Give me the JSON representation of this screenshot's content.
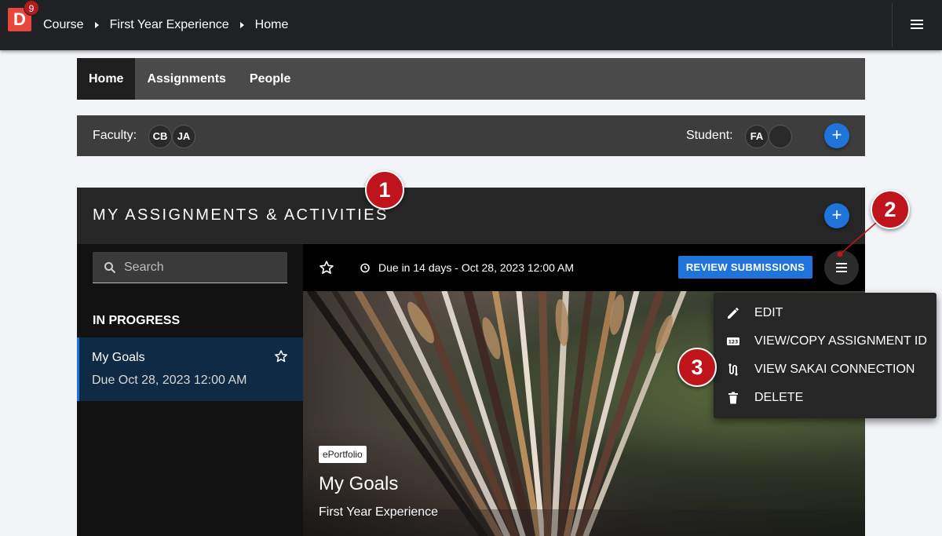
{
  "header": {
    "logo_letter": "D",
    "notification_count": "9",
    "breadcrumb": [
      "Course",
      "First Year Experience",
      "Home"
    ]
  },
  "course_nav": {
    "tabs": [
      {
        "label": "Home",
        "active": true
      },
      {
        "label": "Assignments",
        "active": false
      },
      {
        "label": "People",
        "active": false
      }
    ]
  },
  "members": {
    "faculty_label": "Faculty:",
    "faculty": [
      "CB",
      "JA"
    ],
    "student_label": "Student:",
    "students": [
      "FA",
      ""
    ],
    "add_symbol": "+"
  },
  "assignments": {
    "title": "MY ASSIGNMENTS & ACTIVITIES",
    "add_symbol": "+",
    "search_placeholder": "Search",
    "section_label": "IN PROGRESS",
    "items": [
      {
        "title": "My Goals",
        "due": "Due Oct 28, 2023 12:00 AM"
      }
    ],
    "detail": {
      "due_text": "Due in 14 days - Oct 28, 2023 12:00 AM",
      "review_button": "REVIEW SUBMISSIONS",
      "tag": "ePortfolio",
      "title": "My Goals",
      "subtitle": "First Year Experience"
    }
  },
  "menu": {
    "items": [
      {
        "label": "EDIT",
        "icon": "pencil-icon"
      },
      {
        "label": "VIEW/COPY ASSIGNMENT ID",
        "icon": "id-number-icon"
      },
      {
        "label": "VIEW SAKAI CONNECTION",
        "icon": "connection-icon"
      },
      {
        "label": "DELETE",
        "icon": "trash-icon"
      }
    ]
  },
  "callouts": [
    "1",
    "2",
    "3"
  ],
  "colors": {
    "accent": "#1f74db",
    "callout": "#c0141c",
    "topbar": "#202124",
    "logo": "#e8463a"
  }
}
